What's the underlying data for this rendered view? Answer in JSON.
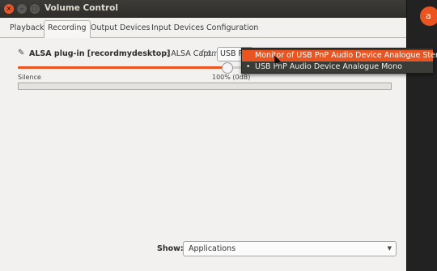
{
  "window": {
    "title": "Volume Control",
    "close_glyph": "×",
    "minimize_glyph": "–",
    "maximize_glyph": "□"
  },
  "desktop": {
    "avatar_letter": "a"
  },
  "tabs": [
    {
      "label": "Playback",
      "active": false
    },
    {
      "label": "Recording",
      "active": true
    },
    {
      "label": "Output Devices",
      "active": false
    },
    {
      "label": "Input Devices",
      "active": false
    },
    {
      "label": "Configuration",
      "active": false
    }
  ],
  "stream": {
    "icon": "pencil-icon",
    "name": "ALSA plug-in [recordmydesktop]",
    "description": ": ALSA Capt…",
    "from_label": "from",
    "device_button_label": "USB P",
    "volume_fraction": 0.56,
    "silence_label": "Silence",
    "max_label": "100% (0dB)"
  },
  "device_menu": {
    "items": [
      {
        "label": "Monitor of USB PnP Audio Device Analogue Stereo",
        "highlighted": true,
        "selected": false
      },
      {
        "label": "USB PnP Audio Device Analogue Mono",
        "highlighted": false,
        "selected": true
      }
    ],
    "bullet_glyph": "•"
  },
  "footer": {
    "show_label": "Show:",
    "show_value": "Applications",
    "arrow_glyph": "▼"
  },
  "colors": {
    "accent": "#e95420",
    "titlebar": "#3c3b37",
    "menu_bg": "#3b3b38"
  }
}
